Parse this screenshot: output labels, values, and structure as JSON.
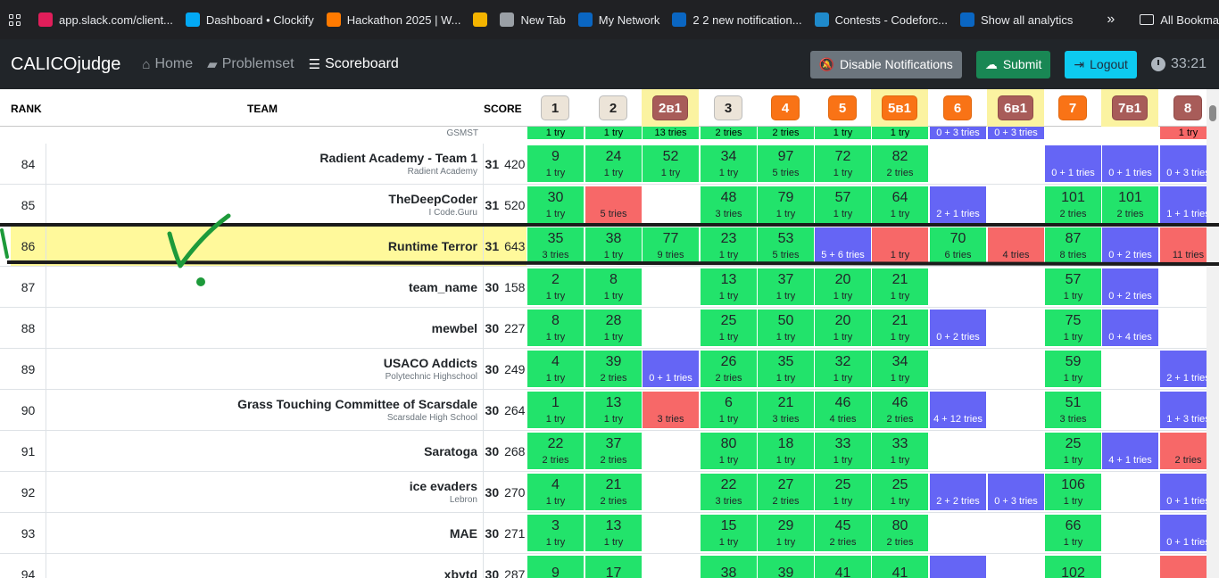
{
  "bookmarks": [
    {
      "label": "app.slack.com/client...",
      "icon": "slack-icon",
      "color": "#e01e5a"
    },
    {
      "label": "Dashboard • Clockify",
      "icon": "clockify-icon",
      "color": "#03a9f4"
    },
    {
      "label": "Hackathon 2025 | W...",
      "icon": "hackathon-icon",
      "color": "#ff7a00"
    },
    {
      "label": "",
      "icon": "bolt-icon",
      "color": "#f4b400"
    },
    {
      "label": "New Tab",
      "icon": "chrome-icon",
      "color": "#9aa0a6"
    },
    {
      "label": "My Network",
      "icon": "linkedin-icon",
      "color": "#0a66c2"
    },
    {
      "label": "2 2 new notification...",
      "icon": "linkedin-icon",
      "color": "#0a66c2"
    },
    {
      "label": "Contests - Codeforc...",
      "icon": "codeforces-icon",
      "color": "#1f8acb"
    },
    {
      "label": "Show all analytics",
      "icon": "linkedin-icon",
      "color": "#0a66c2"
    }
  ],
  "bookmarks_more": "»",
  "all_bookmarks": "All Bookmarks",
  "nav": {
    "brand": "CALICOjudge",
    "home": "Home",
    "problemset": "Problemset",
    "scoreboard": "Scoreboard",
    "disable_notifications": "Disable Notifications",
    "submit": "Submit",
    "logout": "Logout",
    "timer": "33:21"
  },
  "headers": {
    "rank": "RANK",
    "team": "TEAM",
    "score": "SCORE"
  },
  "problems": [
    {
      "label": "1",
      "style": "beige",
      "alt": false
    },
    {
      "label": "2",
      "style": "beige",
      "alt": false
    },
    {
      "label": "2в1",
      "style": "brown",
      "alt": true
    },
    {
      "label": "3",
      "style": "beige",
      "alt": false
    },
    {
      "label": "4",
      "style": "orange",
      "alt": false
    },
    {
      "label": "5",
      "style": "orange",
      "alt": false
    },
    {
      "label": "5в1",
      "style": "orange",
      "alt": true
    },
    {
      "label": "6",
      "style": "orange",
      "alt": false
    },
    {
      "label": "6в1",
      "style": "brown",
      "alt": true
    },
    {
      "label": "7",
      "style": "orange",
      "alt": false
    },
    {
      "label": "7в1",
      "style": "brown",
      "alt": true
    },
    {
      "label": "8",
      "style": "brown",
      "alt": false
    }
  ],
  "partial_row": {
    "rank": "--",
    "affiliation": "GSMST",
    "score": "",
    "cells": [
      {
        "s": "g",
        "tries": "1 try"
      },
      {
        "s": "g",
        "tries": "1 try"
      },
      {
        "s": "g",
        "tries": "13 tries"
      },
      {
        "s": "g",
        "tries": "2 tries"
      },
      {
        "s": "g",
        "tries": "2 tries"
      },
      {
        "s": "g",
        "tries": "1 try"
      },
      {
        "s": "g",
        "tries": "1 try"
      },
      {
        "s": "b",
        "tries": "0 + 3 tries"
      },
      {
        "s": "b",
        "tries": "0 + 3 tries"
      },
      null,
      null,
      {
        "s": "r",
        "tries": "1 try"
      }
    ]
  },
  "rows": [
    {
      "rank": "84",
      "team": "Radient Academy - Team 1",
      "affiliation": "Radient Academy",
      "solved": "31",
      "penalty": "420",
      "highlight": false,
      "cells": [
        {
          "s": "g",
          "time": "9",
          "tries": "1 try"
        },
        {
          "s": "g",
          "time": "24",
          "tries": "1 try"
        },
        {
          "s": "g",
          "time": "52",
          "tries": "1 try"
        },
        {
          "s": "g",
          "time": "34",
          "tries": "1 try"
        },
        {
          "s": "g",
          "time": "97",
          "tries": "5 tries"
        },
        {
          "s": "g",
          "time": "72",
          "tries": "1 try"
        },
        {
          "s": "g",
          "time": "82",
          "tries": "2 tries"
        },
        null,
        null,
        {
          "s": "b",
          "time": "",
          "tries": "0 + 1 tries"
        },
        {
          "s": "b",
          "time": "",
          "tries": "0 + 1 tries"
        },
        {
          "s": "b",
          "time": "",
          "tries": "0 + 3 tries"
        }
      ]
    },
    {
      "rank": "85",
      "team": "TheDeepCoder",
      "affiliation": "I Code.Guru",
      "solved": "31",
      "penalty": "520",
      "highlight": false,
      "cells": [
        {
          "s": "g",
          "time": "30",
          "tries": "1 try"
        },
        {
          "s": "r",
          "time": "",
          "tries": "5 tries"
        },
        null,
        {
          "s": "g",
          "time": "48",
          "tries": "3 tries"
        },
        {
          "s": "g",
          "time": "79",
          "tries": "1 try"
        },
        {
          "s": "g",
          "time": "57",
          "tries": "1 try"
        },
        {
          "s": "g",
          "time": "64",
          "tries": "1 try"
        },
        {
          "s": "b",
          "time": "",
          "tries": "2 + 1 tries"
        },
        null,
        {
          "s": "g",
          "time": "101",
          "tries": "2 tries"
        },
        {
          "s": "g",
          "time": "101",
          "tries": "2 tries"
        },
        {
          "s": "b",
          "time": "",
          "tries": "1 + 1 tries"
        }
      ]
    },
    {
      "rank": "86",
      "team": "Runtime Terror",
      "affiliation": "",
      "solved": "31",
      "penalty": "643",
      "highlight": true,
      "cells": [
        {
          "s": "g",
          "time": "35",
          "tries": "3 tries"
        },
        {
          "s": "g",
          "time": "38",
          "tries": "1 try"
        },
        {
          "s": "g",
          "time": "77",
          "tries": "9 tries"
        },
        {
          "s": "g",
          "time": "23",
          "tries": "1 try"
        },
        {
          "s": "g",
          "time": "53",
          "tries": "5 tries"
        },
        {
          "s": "b",
          "time": "",
          "tries": "5 + 6 tries"
        },
        {
          "s": "r",
          "time": "",
          "tries": "1 try"
        },
        {
          "s": "g",
          "time": "70",
          "tries": "6 tries"
        },
        {
          "s": "r",
          "time": "",
          "tries": "4 tries"
        },
        {
          "s": "g",
          "time": "87",
          "tries": "8 tries"
        },
        {
          "s": "b",
          "time": "",
          "tries": "0 + 2 tries"
        },
        {
          "s": "r",
          "time": "",
          "tries": "11 tries"
        }
      ]
    },
    {
      "rank": "87",
      "team": "team_name",
      "affiliation": "",
      "solved": "30",
      "penalty": "158",
      "highlight": false,
      "cells": [
        {
          "s": "g",
          "time": "2",
          "tries": "1 try"
        },
        {
          "s": "g",
          "time": "8",
          "tries": "1 try"
        },
        null,
        {
          "s": "g",
          "time": "13",
          "tries": "1 try"
        },
        {
          "s": "g",
          "time": "37",
          "tries": "1 try"
        },
        {
          "s": "g",
          "time": "20",
          "tries": "1 try"
        },
        {
          "s": "g",
          "time": "21",
          "tries": "1 try"
        },
        null,
        null,
        {
          "s": "g",
          "time": "57",
          "tries": "1 try"
        },
        {
          "s": "b",
          "time": "",
          "tries": "0 + 2 tries"
        },
        null
      ]
    },
    {
      "rank": "88",
      "team": "mewbel",
      "affiliation": "",
      "solved": "30",
      "penalty": "227",
      "highlight": false,
      "cells": [
        {
          "s": "g",
          "time": "8",
          "tries": "1 try"
        },
        {
          "s": "g",
          "time": "28",
          "tries": "1 try"
        },
        null,
        {
          "s": "g",
          "time": "25",
          "tries": "1 try"
        },
        {
          "s": "g",
          "time": "50",
          "tries": "1 try"
        },
        {
          "s": "g",
          "time": "20",
          "tries": "1 try"
        },
        {
          "s": "g",
          "time": "21",
          "tries": "1 try"
        },
        {
          "s": "b",
          "time": "",
          "tries": "0 + 2 tries"
        },
        null,
        {
          "s": "g",
          "time": "75",
          "tries": "1 try"
        },
        {
          "s": "b",
          "time": "",
          "tries": "0 + 4 tries"
        },
        null
      ]
    },
    {
      "rank": "89",
      "team": "USACO Addicts",
      "affiliation": "Polytechnic Highschool",
      "solved": "30",
      "penalty": "249",
      "highlight": false,
      "cells": [
        {
          "s": "g",
          "time": "4",
          "tries": "1 try"
        },
        {
          "s": "g",
          "time": "39",
          "tries": "2 tries"
        },
        {
          "s": "b",
          "time": "",
          "tries": "0 + 1 tries"
        },
        {
          "s": "g",
          "time": "26",
          "tries": "2 tries"
        },
        {
          "s": "g",
          "time": "35",
          "tries": "1 try"
        },
        {
          "s": "g",
          "time": "32",
          "tries": "1 try"
        },
        {
          "s": "g",
          "time": "34",
          "tries": "1 try"
        },
        null,
        null,
        {
          "s": "g",
          "time": "59",
          "tries": "1 try"
        },
        null,
        {
          "s": "b",
          "time": "",
          "tries": "2 + 1 tries"
        }
      ]
    },
    {
      "rank": "90",
      "team": "Grass Touching Committee of Scarsdale",
      "affiliation": "Scarsdale High School",
      "solved": "30",
      "penalty": "264",
      "highlight": false,
      "cells": [
        {
          "s": "g",
          "time": "1",
          "tries": "1 try"
        },
        {
          "s": "g",
          "time": "13",
          "tries": "1 try"
        },
        {
          "s": "r",
          "time": "",
          "tries": "3 tries"
        },
        {
          "s": "g",
          "time": "6",
          "tries": "1 try"
        },
        {
          "s": "g",
          "time": "21",
          "tries": "3 tries"
        },
        {
          "s": "g",
          "time": "46",
          "tries": "4 tries"
        },
        {
          "s": "g",
          "time": "46",
          "tries": "2 tries"
        },
        {
          "s": "b",
          "time": "",
          "tries": "4 + 12 tries"
        },
        null,
        {
          "s": "g",
          "time": "51",
          "tries": "3 tries"
        },
        null,
        {
          "s": "b",
          "time": "",
          "tries": "1 + 3 tries"
        }
      ]
    },
    {
      "rank": "91",
      "team": "Saratoga",
      "affiliation": "",
      "solved": "30",
      "penalty": "268",
      "highlight": false,
      "cells": [
        {
          "s": "g",
          "time": "22",
          "tries": "2 tries"
        },
        {
          "s": "g",
          "time": "37",
          "tries": "2 tries"
        },
        null,
        {
          "s": "g",
          "time": "80",
          "tries": "1 try"
        },
        {
          "s": "g",
          "time": "18",
          "tries": "1 try"
        },
        {
          "s": "g",
          "time": "33",
          "tries": "1 try"
        },
        {
          "s": "g",
          "time": "33",
          "tries": "1 try"
        },
        null,
        null,
        {
          "s": "g",
          "time": "25",
          "tries": "1 try"
        },
        {
          "s": "b",
          "time": "",
          "tries": "4 + 1 tries"
        },
        {
          "s": "r",
          "time": "",
          "tries": "2 tries"
        }
      ]
    },
    {
      "rank": "92",
      "team": "ice evaders",
      "affiliation": "Lebron",
      "solved": "30",
      "penalty": "270",
      "highlight": false,
      "cells": [
        {
          "s": "g",
          "time": "4",
          "tries": "1 try"
        },
        {
          "s": "g",
          "time": "21",
          "tries": "2 tries"
        },
        null,
        {
          "s": "g",
          "time": "22",
          "tries": "3 tries"
        },
        {
          "s": "g",
          "time": "27",
          "tries": "2 tries"
        },
        {
          "s": "g",
          "time": "25",
          "tries": "1 try"
        },
        {
          "s": "g",
          "time": "25",
          "tries": "1 try"
        },
        {
          "s": "b",
          "time": "",
          "tries": "2 + 2 tries"
        },
        {
          "s": "b",
          "time": "",
          "tries": "0 + 3 tries"
        },
        {
          "s": "g",
          "time": "106",
          "tries": "1 try"
        },
        null,
        {
          "s": "b",
          "time": "",
          "tries": "0 + 1 tries"
        }
      ]
    },
    {
      "rank": "93",
      "team": "MAE",
      "affiliation": "",
      "solved": "30",
      "penalty": "271",
      "highlight": false,
      "cells": [
        {
          "s": "g",
          "time": "3",
          "tries": "1 try"
        },
        {
          "s": "g",
          "time": "13",
          "tries": "1 try"
        },
        null,
        {
          "s": "g",
          "time": "15",
          "tries": "1 try"
        },
        {
          "s": "g",
          "time": "29",
          "tries": "1 try"
        },
        {
          "s": "g",
          "time": "45",
          "tries": "2 tries"
        },
        {
          "s": "g",
          "time": "80",
          "tries": "2 tries"
        },
        null,
        null,
        {
          "s": "g",
          "time": "66",
          "tries": "1 try"
        },
        null,
        {
          "s": "b",
          "time": "",
          "tries": "0 + 1 tries"
        }
      ]
    },
    {
      "rank": "94",
      "team": "xbytd",
      "affiliation": "",
      "solved": "30",
      "penalty": "287",
      "highlight": false,
      "cells": [
        {
          "s": "g",
          "time": "9",
          "tries": ""
        },
        {
          "s": "g",
          "time": "17",
          "tries": ""
        },
        null,
        {
          "s": "g",
          "time": "38",
          "tries": ""
        },
        {
          "s": "g",
          "time": "39",
          "tries": ""
        },
        {
          "s": "g",
          "time": "41",
          "tries": ""
        },
        {
          "s": "g",
          "time": "41",
          "tries": ""
        },
        {
          "s": "b",
          "time": "",
          "tries": ""
        },
        null,
        {
          "s": "g",
          "time": "102",
          "tries": ""
        },
        null,
        {
          "s": "r",
          "time": "",
          "tries": ""
        }
      ]
    }
  ]
}
